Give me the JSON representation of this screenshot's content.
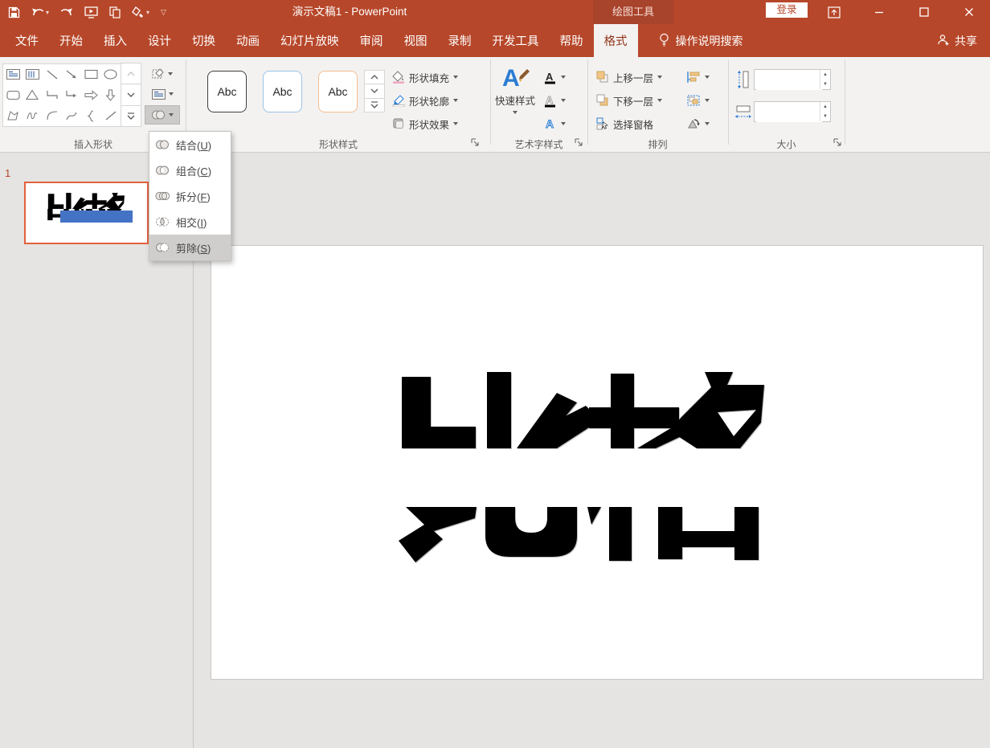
{
  "titlebar": {
    "title": "演示文稿1 - PowerPoint",
    "contextual_tool": "绘图工具",
    "signin_label": "登录"
  },
  "tabs": [
    "文件",
    "开始",
    "插入",
    "设计",
    "切换",
    "动画",
    "幻灯片放映",
    "审阅",
    "视图",
    "录制",
    "开发工具",
    "帮助",
    "格式"
  ],
  "search": {
    "label": "操作说明搜索"
  },
  "share": {
    "label": "共享"
  },
  "ribbon": {
    "groups": {
      "insert_shapes": "插入形状",
      "shape_styles": "形状样式",
      "wordart": "艺术字样式",
      "arrange": "排列",
      "size": "大小"
    },
    "shape_styles": {
      "swatch_label": "Abc",
      "fill": "形状填充",
      "outline": "形状轮廓",
      "effects": "形状效果"
    },
    "wordart": {
      "quick_styles": "快速样式"
    },
    "arrange": {
      "bring_forward": "上移一层",
      "send_backward": "下移一层",
      "selection_pane": "选择窗格"
    },
    "size": {
      "height_value": "",
      "width_value": ""
    }
  },
  "merge_menu": {
    "items": [
      {
        "name": "结合",
        "accel": "U"
      },
      {
        "name": "组合",
        "accel": "C"
      },
      {
        "name": "拆分",
        "accel": "F"
      },
      {
        "name": "相交",
        "accel": "I"
      },
      {
        "name": "剪除",
        "accel": "S"
      }
    ]
  },
  "punct": {
    "l": "(",
    "r": ")"
  },
  "slides": {
    "number": "1",
    "text": "比格"
  },
  "colors": {
    "title_red": "#b7472a",
    "accent_blue": "#4472c4",
    "selection_orange": "#e2613e",
    "shape_black": "#000000"
  }
}
